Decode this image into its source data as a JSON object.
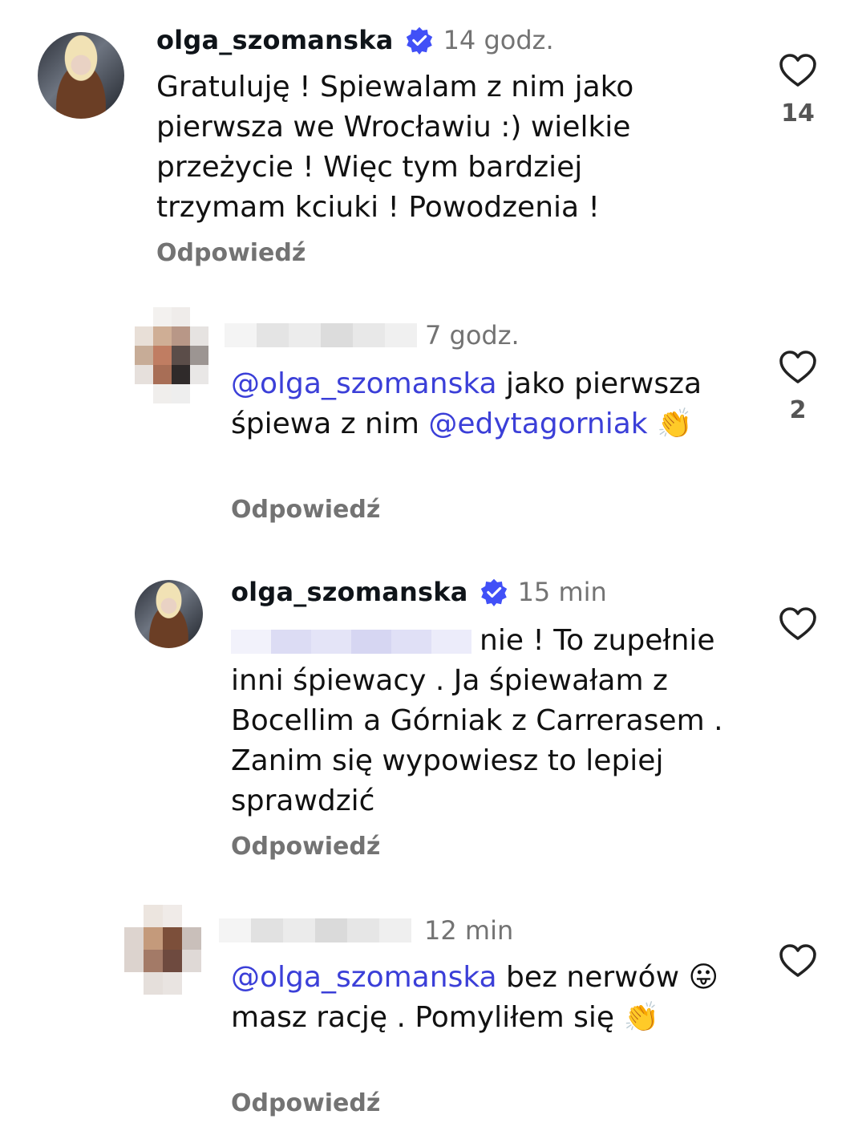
{
  "comments": [
    {
      "username": "olga_szomanska",
      "verified": true,
      "time": "14 godz.",
      "text": "Gratuluję ! Spiewalam z nim jako pierwsza we Wrocławiu :) wielkie przeżycie ! Więc tym bardziej trzymam kciuki ! Powodzenia !",
      "likes": "14",
      "reply_label": "Odpowiedź"
    },
    {
      "username": "",
      "verified": false,
      "time": "7 godz.",
      "mention1": "@olga_szomanska",
      "text1": " jako pierwsza śpiewa z nim ",
      "mention2": "@edytagorniak",
      "emoji": "👏",
      "likes": "2",
      "reply_label": "Odpowiedź"
    },
    {
      "username": "olga_szomanska",
      "verified": true,
      "time": "15 min",
      "text": "nie ! To zupełnie inni śpiewacy . Ja śpiewałam z Bocellim a Górniak z Carrerasem . Zanim się wypowiesz to lepiej sprawdzić",
      "reply_label": "Odpowiedź"
    },
    {
      "username": "",
      "verified": false,
      "time": "12 min",
      "mention1": "@olga_szomanska",
      "text1": " bez nerwów ",
      "emoji1": "😛",
      "text2": " masz rację . Pomyliłem się ",
      "emoji2": "👏",
      "reply_label": "Odpowiedź"
    }
  ],
  "colors": {
    "mention": "#3b3fd8",
    "verified": "#4150f7",
    "secondary_text": "#737373"
  },
  "icons": {
    "like": "heart-outline-icon",
    "verified": "verified-badge-icon"
  }
}
